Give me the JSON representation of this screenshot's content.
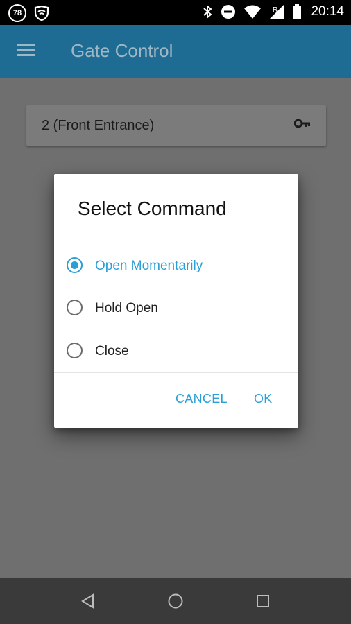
{
  "status_bar": {
    "notification_badge": "78",
    "time": "20:14"
  },
  "app_bar": {
    "title": "Gate Control"
  },
  "gate_card": {
    "label": "2 (Front Entrance)"
  },
  "dialog": {
    "title": "Select Command",
    "options": [
      {
        "label": "Open Momentarily",
        "selected": true
      },
      {
        "label": "Hold Open",
        "selected": false
      },
      {
        "label": "Close",
        "selected": false
      }
    ],
    "cancel_label": "CANCEL",
    "ok_label": "OK"
  },
  "colors": {
    "app_bar": "#1e6c94",
    "accent": "#2a9fd6",
    "scrim_background": "#6f6f6f"
  }
}
